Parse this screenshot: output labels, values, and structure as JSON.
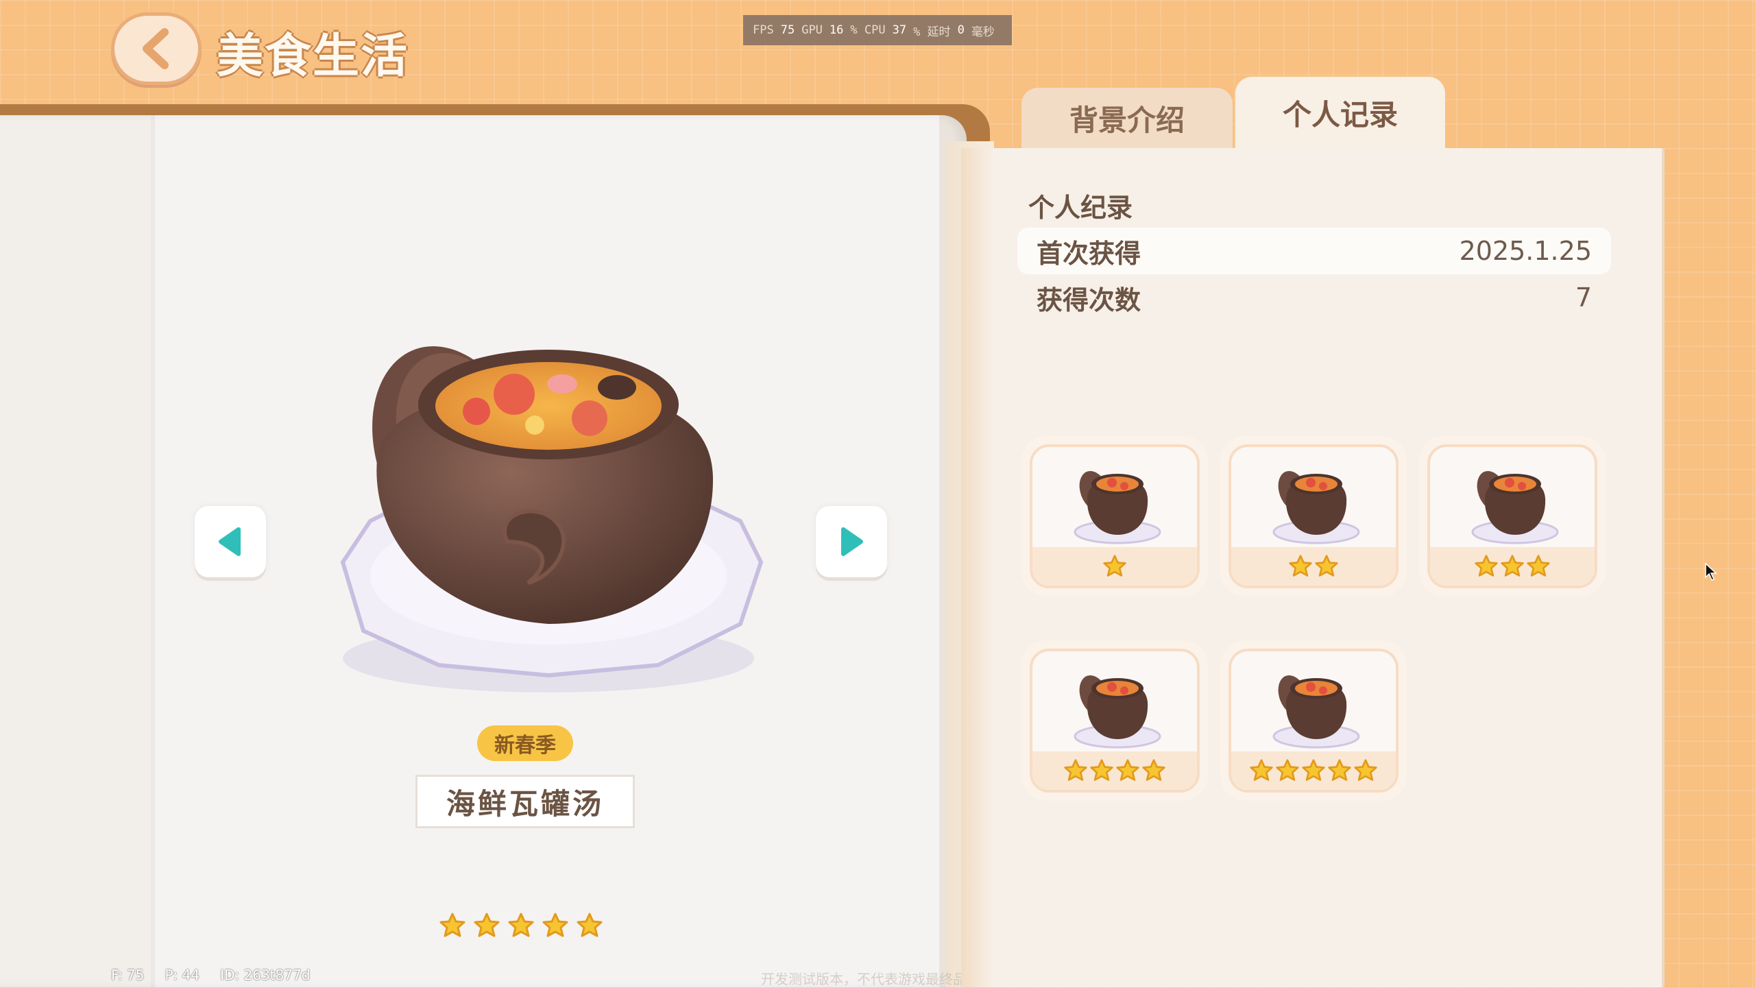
{
  "header": {
    "title": "美食生活",
    "perf": {
      "fps_label": "FPS",
      "fps": "75",
      "gpu_label": "GPU",
      "gpu": "16",
      "cpu_label": "% CPU",
      "cpu": "37",
      "latency_label": "% 延时",
      "latency": "0",
      "latency_unit": "毫秒"
    }
  },
  "dish": {
    "season": "新春季",
    "name": "海鲜瓦罐汤",
    "stars": 5
  },
  "tabs": [
    {
      "label": "背景介绍",
      "active": false
    },
    {
      "label": "个人记录",
      "active": true
    }
  ],
  "record": {
    "section_title": "个人纪录",
    "rows": [
      {
        "label": "首次获得",
        "value": "2025.1.25"
      },
      {
        "label": "获得次数",
        "value": "7"
      }
    ]
  },
  "quality_cards": [
    {
      "stars": 1
    },
    {
      "stars": 2
    },
    {
      "stars": 3
    },
    {
      "stars": 4
    },
    {
      "stars": 5
    }
  ],
  "footer": {
    "fps": "F: 75",
    "ping": "P: 44",
    "id": "ID: 263t877d",
    "note": "开发测试版本，不代表游戏最终品质"
  },
  "colors": {
    "background": "#f8c081",
    "accent_teal": "#2fbfb8",
    "star_gold": "#f7c530"
  }
}
